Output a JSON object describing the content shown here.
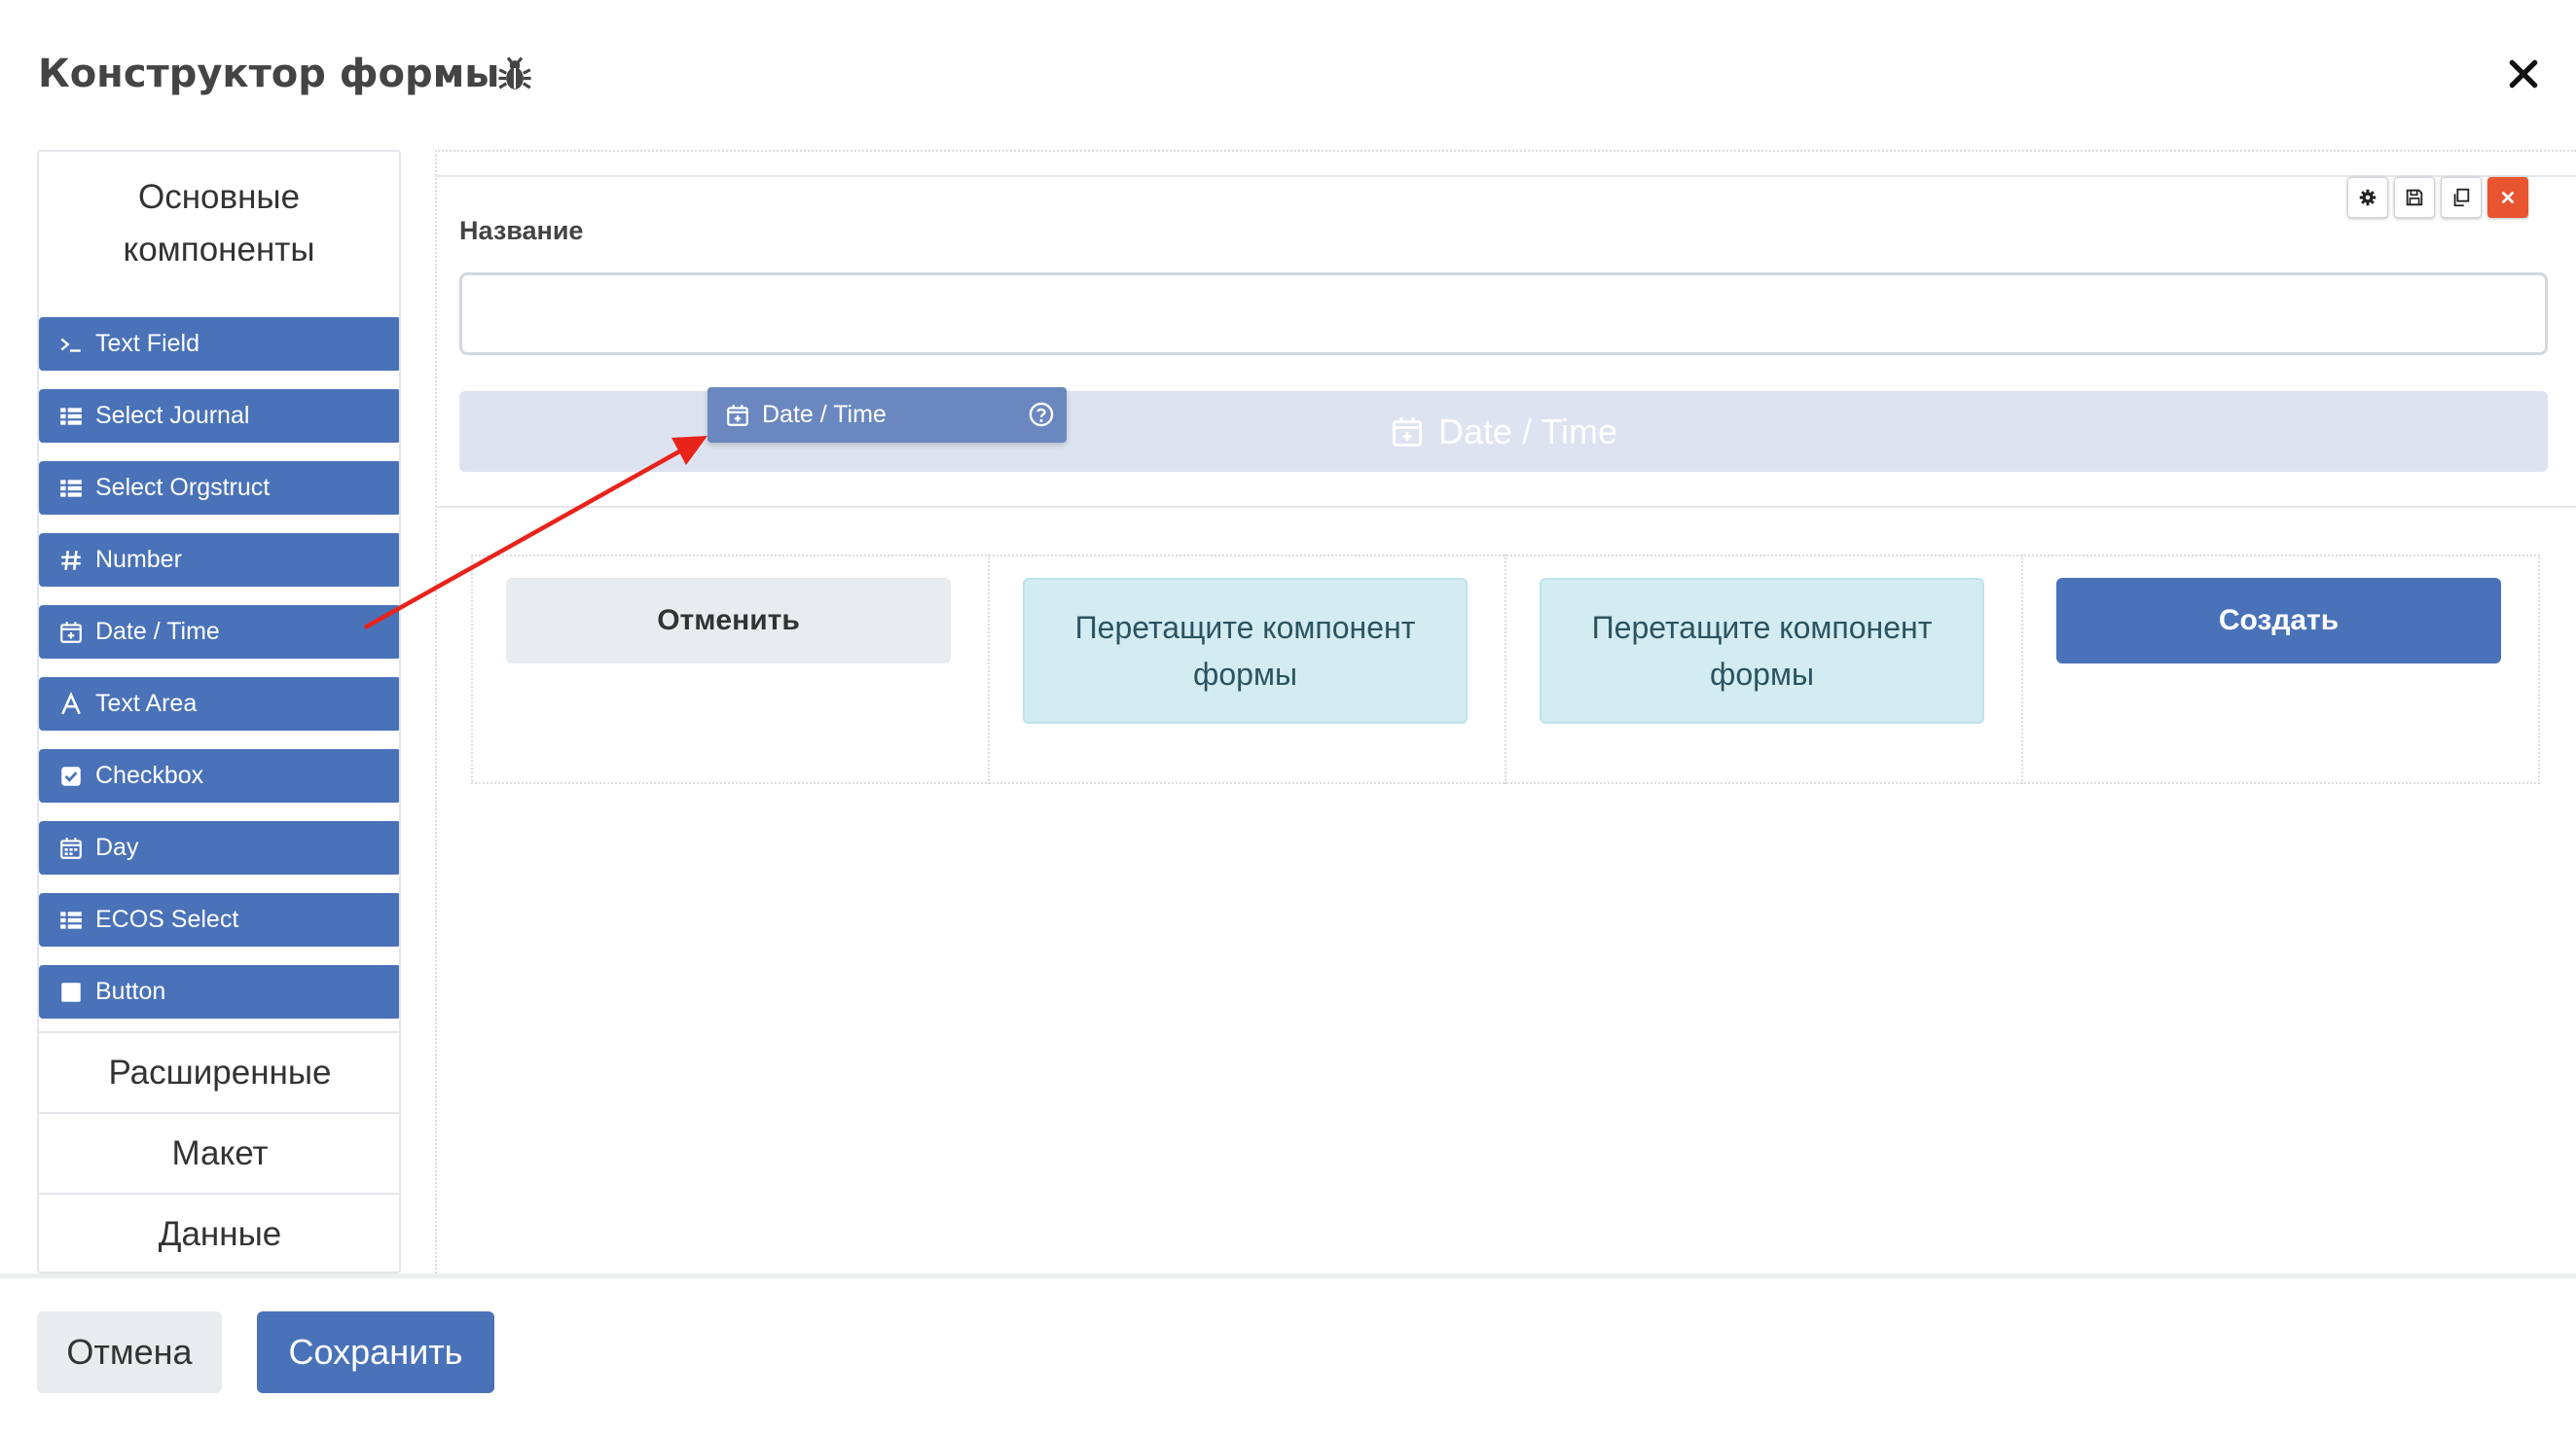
{
  "header": {
    "title": "Конструктор формы",
    "debug_icon": "bug-icon",
    "close_icon": "close-icon"
  },
  "sidebar": {
    "heading": "Основные компоненты",
    "items": [
      {
        "label": "Text Field",
        "icon": "terminal-icon"
      },
      {
        "label": "Select Journal",
        "icon": "list-icon"
      },
      {
        "label": "Select Orgstruct",
        "icon": "list-icon"
      },
      {
        "label": "Number",
        "icon": "hash-icon"
      },
      {
        "label": "Date / Time",
        "icon": "calendar-plus-icon"
      },
      {
        "label": "Text Area",
        "icon": "font-icon"
      },
      {
        "label": "Checkbox",
        "icon": "check-square-icon"
      },
      {
        "label": "Day",
        "icon": "calendar-icon"
      },
      {
        "label": "ECOS Select",
        "icon": "list-icon"
      },
      {
        "label": "Button",
        "icon": "square-icon"
      }
    ],
    "sections": [
      "Расширенные",
      "Макет",
      "Данные"
    ]
  },
  "canvas": {
    "field_label": "Название",
    "name_value": "",
    "drop_zone_label": "Date / Time",
    "drag_ghost_label": "Date / Time",
    "tools": [
      "gear-icon",
      "save-icon",
      "copy-icon",
      "remove-icon"
    ],
    "buttons": {
      "cancel": "Отменить",
      "create": "Создать",
      "placeholder_1": "Перетащите компонент формы",
      "placeholder_2": "Перетащите компонент формы"
    }
  },
  "footer": {
    "cancel": "Отмена",
    "save": "Сохранить"
  },
  "colors": {
    "primary": "#4a72b8",
    "drag_ghost": "#6a88bf",
    "drop_zone": "#dde3f0",
    "placeholder": "#d2ecf1",
    "danger": "#e8542f",
    "arrow": "#e8231a"
  }
}
